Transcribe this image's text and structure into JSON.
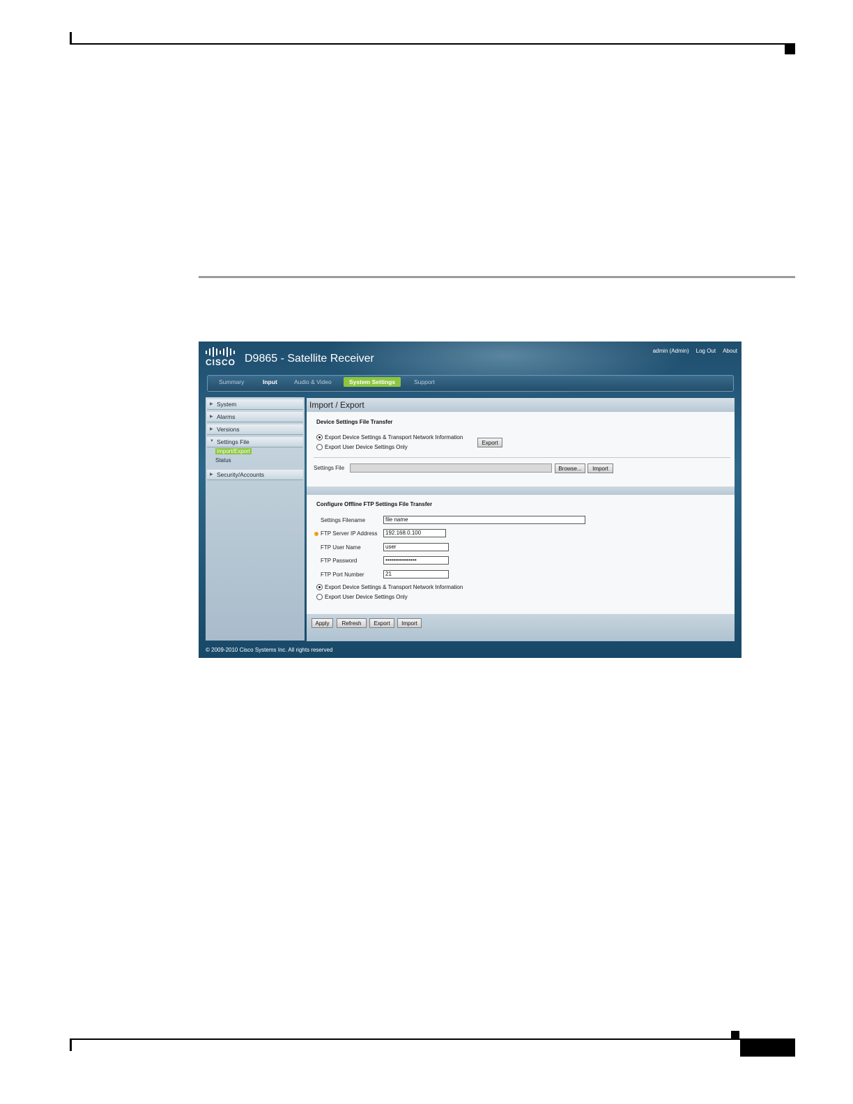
{
  "app": {
    "logo_text": "CISCO",
    "title": "D9865 - Satellite Receiver",
    "top_links": {
      "user": "admin (Admin)",
      "logout": "Log Out",
      "about": "About"
    }
  },
  "nav": {
    "tabs": [
      "Summary",
      "Input",
      "Audio & Video",
      "System Settings",
      "Support"
    ],
    "active": "System Settings"
  },
  "sidebar": {
    "items": [
      "System",
      "Alarms",
      "Versions",
      "Settings File",
      "Security/Accounts"
    ],
    "sub_items": [
      "Import/Export",
      "Status"
    ],
    "active_sub": "Import/Export"
  },
  "main": {
    "heading": "Import / Export",
    "transfer": {
      "title": "Device Settings File Transfer",
      "option_all": "Export Device Settings & Transport Network Information",
      "option_user": "Export User Device Settings Only",
      "selected": "all",
      "export_button": "Export",
      "settings_file_label": "Settings File",
      "settings_file_value": "",
      "browse_button": "Browse...",
      "import_button": "Import"
    },
    "ftp": {
      "title": "Configure Offline FTP Settings File Transfer",
      "filename_label": "Settings Filename",
      "filename_value": "file name",
      "ip_label": "FTP Server IP Address",
      "ip_value": "192.168.0.100",
      "user_label": "FTP User Name",
      "user_value": "user",
      "password_label": "FTP Password",
      "password_value": "••••••••••••••••",
      "port_label": "FTP Port Number",
      "port_value": "21",
      "option_all": "Export Device Settings & Transport Network Information",
      "option_user": "Export User Device Settings Only",
      "selected": "all"
    },
    "actions": {
      "apply": "Apply",
      "refresh": "Refresh",
      "export": "Export",
      "import": "Import"
    }
  },
  "footer": {
    "copyright": "© 2009-2010 Cisco Systems Inc. All rights reserved"
  },
  "colors": {
    "accent": "#8cc63f",
    "header": "#2e6789",
    "required": "#f29c1f"
  }
}
